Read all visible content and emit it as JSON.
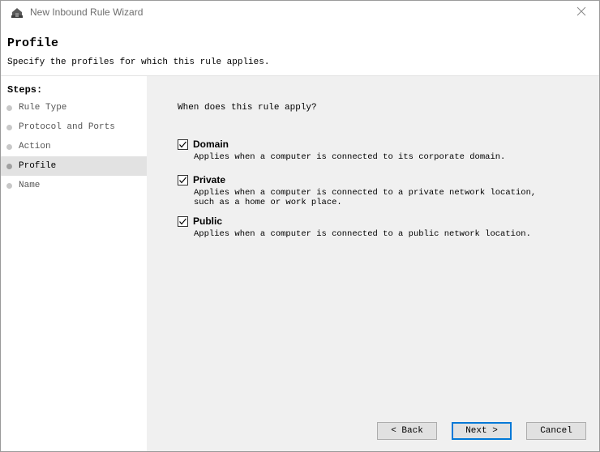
{
  "window": {
    "title": "New Inbound Rule Wizard",
    "close_symbol": "×",
    "app_icon": "firewall-wizard-icon"
  },
  "header": {
    "title": "Profile",
    "subtitle": "Specify the profiles for which this rule applies."
  },
  "steps": {
    "title": "Steps:",
    "items": [
      {
        "label": "Rule Type",
        "active": false
      },
      {
        "label": "Protocol and Ports",
        "active": false
      },
      {
        "label": "Action",
        "active": false
      },
      {
        "label": "Profile",
        "active": true
      },
      {
        "label": "Name",
        "active": false
      }
    ]
  },
  "main": {
    "question": "When does this rule apply?",
    "options": [
      {
        "label": "Domain",
        "checked": true,
        "description": "Applies when a computer is connected to its corporate domain."
      },
      {
        "label": "Private",
        "checked": true,
        "description": "Applies when a computer is connected to a private network location,\nsuch as a home or work place."
      },
      {
        "label": "Public",
        "checked": true,
        "description": "Applies when a computer is connected to a public network location."
      }
    ]
  },
  "buttons": {
    "back": "< Back",
    "next": "Next >",
    "cancel": "Cancel"
  },
  "colors": {
    "accent": "#0078d7",
    "body_background": "#f0f0f0",
    "active_step": "#e2e2e2"
  }
}
